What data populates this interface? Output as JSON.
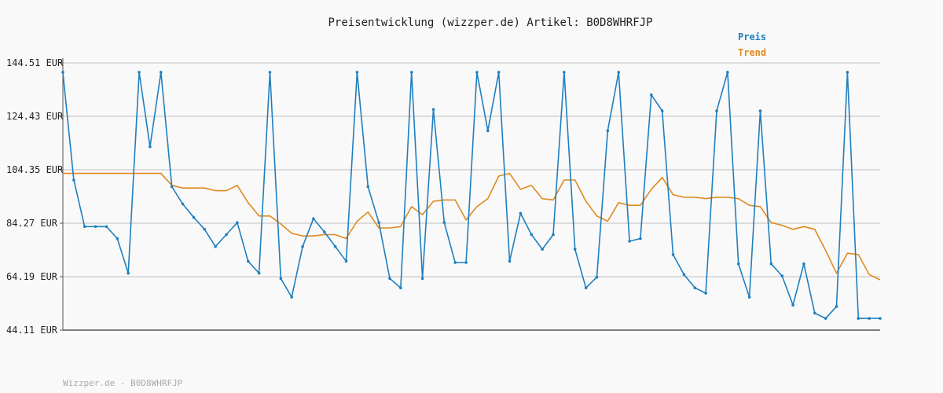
{
  "chart_data": {
    "type": "line",
    "title": "Preisentwicklung (wizzper.de) Artikel: B0D8WHRFJP",
    "yunit": "EUR",
    "ylim": [
      44.11,
      144.51
    ],
    "yticks": [
      "144.51 EUR",
      "124.43 EUR",
      "104.35 EUR",
      "84.27 EUR",
      "64.19 EUR",
      "44.11 EUR"
    ],
    "ytick_values": [
      144.51,
      124.43,
      104.35,
      84.27,
      64.19,
      44.11
    ],
    "grid": true,
    "legend_position": "top-right",
    "footer": "Wizzper.de - B0D8WHRFJP",
    "series": [
      {
        "name": "Preis",
        "color": "#1f7fbf",
        "values": [
          141.0,
          100.5,
          83.0,
          83.0,
          83.0,
          78.5,
          65.5,
          141.0,
          113.0,
          141.0,
          98.0,
          91.5,
          86.5,
          82.0,
          75.5,
          80.0,
          84.5,
          70.0,
          65.5,
          141.0,
          63.5,
          56.5,
          75.5,
          86.0,
          81.0,
          75.5,
          70.0,
          141.0,
          98.0,
          84.5,
          63.5,
          60.0,
          141.0,
          63.5,
          127.0,
          84.5,
          69.5,
          69.5,
          141.0,
          119.0,
          141.0,
          70.0,
          88.0,
          80.0,
          74.5,
          80.0,
          141.0,
          74.5,
          60.0,
          64.0,
          119.0,
          141.0,
          77.5,
          78.5,
          132.5,
          126.5,
          72.5,
          65.0,
          60.0,
          58.0,
          126.5,
          141.0,
          69.0,
          56.5,
          126.5,
          69.0,
          64.5,
          53.5,
          69.0,
          50.5,
          48.5,
          53.0,
          141.0,
          48.5,
          48.5,
          48.5
        ]
      },
      {
        "name": "Trend",
        "color": "#e08a1e",
        "values": [
          103.0,
          103.0,
          103.0,
          103.0,
          103.0,
          103.0,
          103.0,
          103.0,
          103.0,
          103.0,
          98.5,
          97.5,
          97.5,
          97.5,
          96.5,
          96.5,
          98.5,
          92.0,
          87.0,
          87.0,
          84.0,
          80.5,
          79.5,
          79.5,
          80.0,
          80.0,
          78.5,
          85.0,
          88.5,
          82.5,
          82.5,
          83.0,
          90.5,
          87.5,
          92.5,
          93.0,
          93.0,
          85.5,
          90.5,
          93.5,
          102.0,
          103.0,
          97.0,
          98.5,
          93.5,
          93.0,
          100.5,
          100.5,
          92.5,
          87.0,
          85.0,
          92.0,
          91.0,
          91.0,
          97.0,
          101.5,
          95.0,
          94.0,
          94.0,
          93.5,
          94.0,
          94.0,
          93.5,
          91.0,
          90.5,
          84.5,
          83.5,
          82.0,
          83.0,
          82.0,
          74.0,
          65.5,
          73.0,
          72.5,
          65.0,
          63.0
        ]
      }
    ]
  }
}
